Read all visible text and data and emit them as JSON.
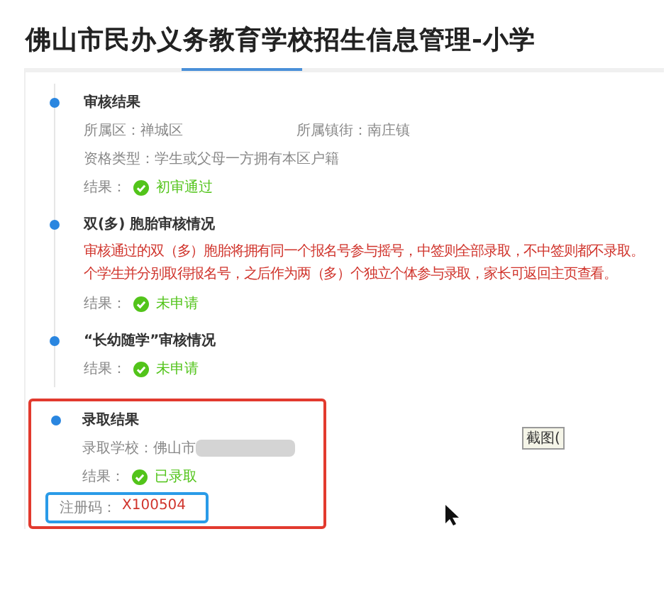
{
  "page_title": "佛山市民办义务教育学校招生信息管理-小学",
  "sections": [
    {
      "title": "审核结果",
      "highlighted": false,
      "fields": [
        [
          {
            "label": "所属区：",
            "value": "禅城区"
          },
          {
            "label": "所属镇街：",
            "value": "南庄镇"
          }
        ],
        [
          {
            "label": "资格类型：",
            "value": "学生或父母一方拥有本区户籍"
          }
        ]
      ],
      "result_label": "结果：",
      "result": "初审通过"
    },
    {
      "title": "双(多) 胞胎审核情况",
      "highlighted": false,
      "notes": [
        "审核通过的双（多）胞胎将拥有同一个报名号参与摇号，中签则全部录取，不中签则都不录取。",
        "个学生并分别取得报名号，之后作为两（多）个独立个体参与录取，家长可返回主页查看。"
      ],
      "result_label": "结果：",
      "result": "未申请"
    },
    {
      "title": "“长幼随学”审核情况",
      "highlighted": false,
      "result_label": "结果：",
      "result": "未申请"
    },
    {
      "title": "录取结果",
      "highlighted": true,
      "fields": [
        [
          {
            "label": "录取学校：",
            "value": "佛山市",
            "redacted": true
          }
        ]
      ],
      "result_label": "结果：",
      "result": "已录取",
      "code": {
        "label": "注册码：",
        "value": "X100504",
        "highlighted": true
      }
    }
  ],
  "tooltip": "截图("
}
